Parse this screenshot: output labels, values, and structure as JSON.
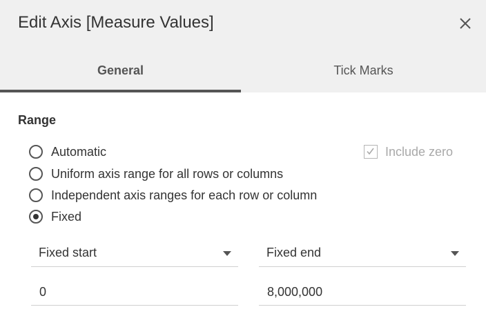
{
  "dialog": {
    "title": "Edit Axis [Measure Values]",
    "close_icon": "close-icon"
  },
  "tabs": [
    {
      "label": "General",
      "active": true
    },
    {
      "label": "Tick Marks",
      "active": false
    }
  ],
  "range": {
    "section_label": "Range",
    "options": [
      {
        "label": "Automatic",
        "selected": false
      },
      {
        "label": "Uniform axis range for all rows or columns",
        "selected": false
      },
      {
        "label": "Independent axis ranges for each row or column",
        "selected": false
      },
      {
        "label": "Fixed",
        "selected": true
      }
    ],
    "include_zero": {
      "label": "Include zero",
      "checked": true,
      "disabled": true
    },
    "start_mode": "Fixed start",
    "end_mode": "Fixed end",
    "start_value": "0",
    "end_value": "8,000,000"
  },
  "colors": {
    "header_bg": "#f0f0f0",
    "active_tab_underline": "#555555",
    "text": "#333333",
    "disabled_text": "#a9a9a9"
  }
}
